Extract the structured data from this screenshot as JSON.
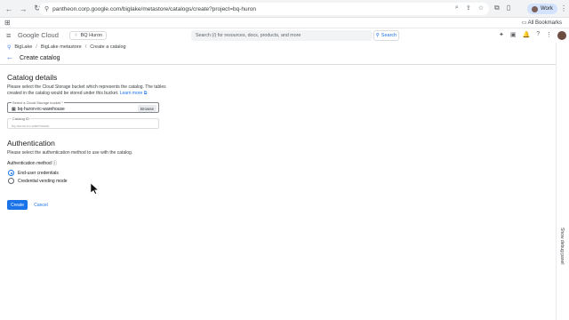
{
  "browser": {
    "url": "pantheon.corp.google.com/biglake/metastore/catalogs/create?project=bq-huron",
    "profile": "Work",
    "bookmarks_all": "All Bookmarks"
  },
  "header": {
    "logo": "Google Cloud",
    "project": "BQ Huron",
    "search_placeholder": "Search (/) for resources, docs, products, and more",
    "search_button": "Search"
  },
  "breadcrumb": {
    "items": [
      "BigLake",
      "BigLake metastore",
      "Create a catalog"
    ]
  },
  "page": {
    "title": "Create catalog"
  },
  "catalog": {
    "title": "Catalog details",
    "description_line1": "Please select the Cloud Storage bucket which represents the catalog. The tables",
    "description_line2": "created in the catalog would be stored under this bucket.",
    "learn_more": "Learn more",
    "bucket_label": "Select a Cloud Storage bucket *",
    "bucket_value": "bq-huron-irc-warehouse",
    "browse": "Browse",
    "catalog_id_label": "Catalog ID",
    "catalog_id_placeholder": "bq-huron-irc-warehouse"
  },
  "auth": {
    "title": "Authentication",
    "description": "Please select the authentication method to use with the catalog.",
    "method_label": "Authentication method",
    "options": [
      "End-user credentials",
      "Credential vending mode"
    ],
    "selected": "End-user credentials"
  },
  "actions": {
    "create": "Create",
    "cancel": "Cancel"
  },
  "side_panel": {
    "label": "Show debug panel"
  },
  "colors": {
    "accent": "#1a73e8"
  }
}
